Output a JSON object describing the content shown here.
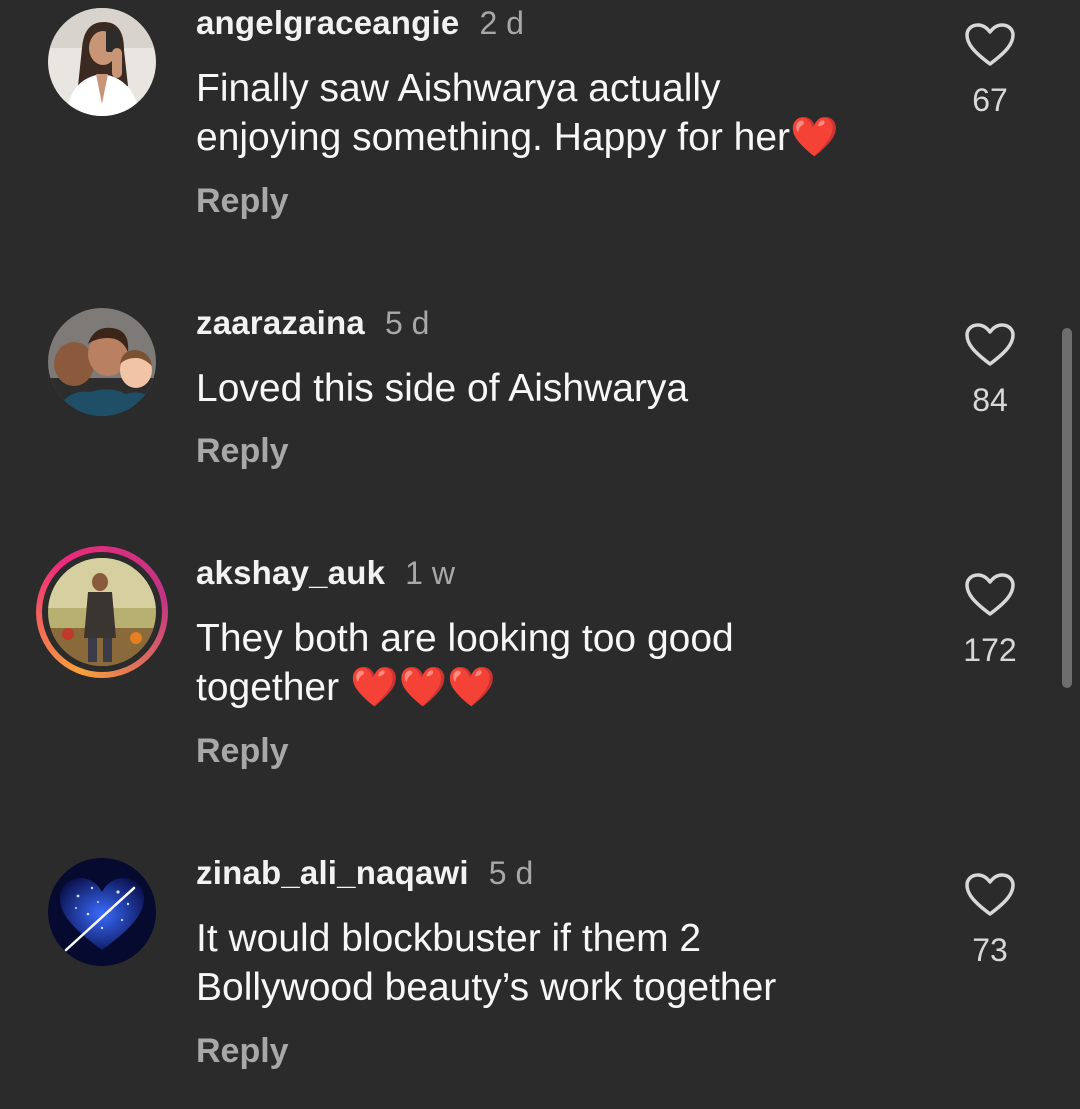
{
  "comments": [
    {
      "username": "angelgraceangie",
      "time": "2 d",
      "text": "Finally saw Aishwarya actually\nenjoying something. Happy for her❤️",
      "reply": "Reply",
      "likes": "67",
      "avatar": "woman-selfie-avatar",
      "has_story": false
    },
    {
      "username": "zaarazaina",
      "time": "5 d",
      "text": "Loved this side of Aishwarya",
      "reply": "Reply",
      "likes": "84",
      "avatar": "kids-group-avatar",
      "has_story": false
    },
    {
      "username": "akshay_auk",
      "time": "1 w",
      "text": "They both are looking too good\ntogether ❤️❤️❤️",
      "reply": "Reply",
      "likes": "172",
      "avatar": "man-standing-avatar",
      "has_story": true
    },
    {
      "username": "zinab_ali_naqawi",
      "time": "5 d",
      "text": "It would blockbuster if them 2\nBollywood beauty’s work together",
      "reply": "Reply",
      "likes": "73",
      "avatar": "blue-glitter-heart-avatar",
      "has_story": false
    }
  ],
  "colors": {
    "background": "#2b2b2b",
    "text_primary": "#f5f5f5",
    "text_secondary": "#a8a8a8",
    "heart": "#e8202f",
    "story_ring": [
      "#f9a13a",
      "#ee2a7b",
      "#c13584"
    ]
  }
}
